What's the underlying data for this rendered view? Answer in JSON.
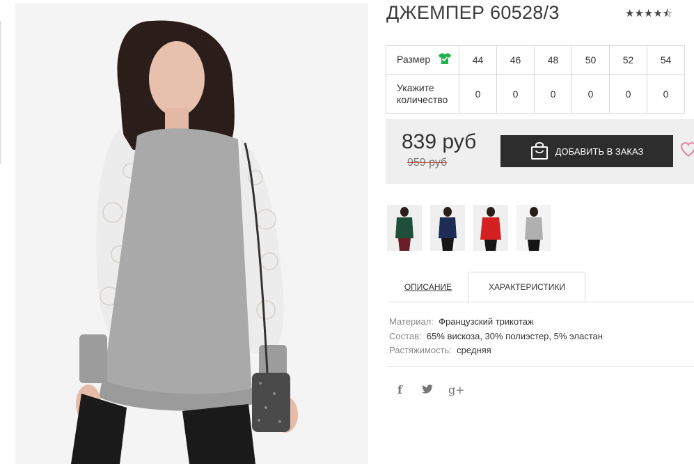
{
  "product": {
    "title": "ДЖЕМПЕР 60528/3",
    "rating_stars": "★★★★⯪",
    "rating_value": 4.5
  },
  "size_table": {
    "size_label": "Размер",
    "sizes": [
      "44",
      "46",
      "48",
      "50",
      "52",
      "54"
    ],
    "qty_label": "Укажите количество",
    "quantities": [
      "0",
      "0",
      "0",
      "0",
      "0",
      "0"
    ]
  },
  "pricing": {
    "price": "839 руб",
    "old_price": "959 руб",
    "add_button": "ДОБАВИТЬ В ЗАКАЗ"
  },
  "thumbnails": [
    {
      "color_name": "green"
    },
    {
      "color_name": "navy"
    },
    {
      "color_name": "red"
    },
    {
      "color_name": "grey"
    }
  ],
  "tabs": {
    "description": "ОПИСАНИЕ",
    "characteristics": "ХАРАКТЕРИСТИКИ"
  },
  "specs": [
    {
      "key": "Материал:",
      "value": "Французский трикотаж"
    },
    {
      "key": "Состав:",
      "value": "65% вискоза, 30% полиэстер, 5% эластан"
    },
    {
      "key": "Растяжимость:",
      "value": "средняя"
    }
  ],
  "social": {
    "facebook": "f",
    "twitter": "🐦",
    "googleplus": "g+"
  },
  "colors": {
    "button_bg": "#2d2d2d",
    "price_box_bg": "#efefef",
    "size_icon_green": "#22b14c",
    "heart": "#e0779a",
    "strike_red": "#c0392b"
  }
}
